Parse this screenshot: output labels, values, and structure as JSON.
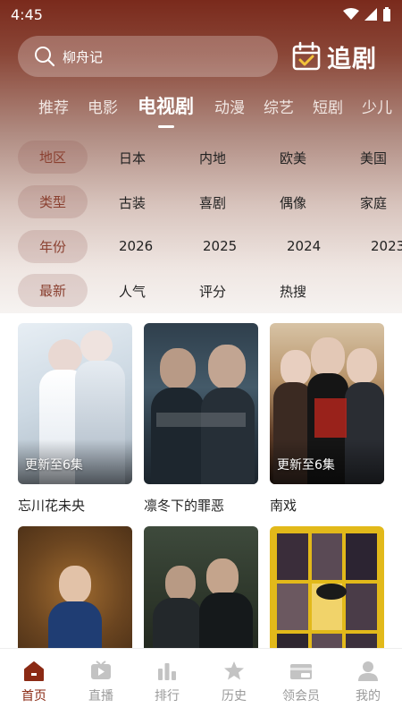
{
  "status_bar": {
    "time": "4:45"
  },
  "search": {
    "placeholder": "柳舟记"
  },
  "follow": {
    "label": "追剧",
    "icon": "calendar-check-icon"
  },
  "tabs": [
    {
      "label": "推荐"
    },
    {
      "label": "电影"
    },
    {
      "label": "电视剧",
      "active": true
    },
    {
      "label": "动漫"
    },
    {
      "label": "综艺"
    },
    {
      "label": "短剧"
    },
    {
      "label": "少儿"
    }
  ],
  "filters": [
    {
      "label": "地区",
      "options": [
        "日本",
        "内地",
        "欧美",
        "美国"
      ]
    },
    {
      "label": "类型",
      "options": [
        "古装",
        "喜剧",
        "偶像",
        "家庭"
      ]
    },
    {
      "label": "年份",
      "options": [
        "2026",
        "2025",
        "2024",
        "2023"
      ]
    },
    {
      "label": "最新",
      "options": [
        "人气",
        "评分",
        "热搜"
      ]
    }
  ],
  "cards": [
    {
      "title": "忘川花未央",
      "badge": "更新至6集"
    },
    {
      "title": "凛冬下的罪恶",
      "badge": ""
    },
    {
      "title": "南戏",
      "badge": "更新至6集"
    },
    {
      "title": "",
      "badge": ""
    },
    {
      "title": "",
      "badge": ""
    },
    {
      "title": "",
      "badge": ""
    }
  ],
  "bottom_nav": [
    {
      "label": "首页",
      "icon": "home-icon",
      "active": true
    },
    {
      "label": "直播",
      "icon": "tv-play-icon"
    },
    {
      "label": "排行",
      "icon": "bar-chart-icon"
    },
    {
      "label": "历史",
      "icon": "star-history-icon"
    },
    {
      "label": "领会员",
      "icon": "vip-card-icon"
    },
    {
      "label": "我的",
      "icon": "person-icon"
    }
  ],
  "colors": {
    "accent": "#8b2a14",
    "header": "#7a2a1c"
  }
}
